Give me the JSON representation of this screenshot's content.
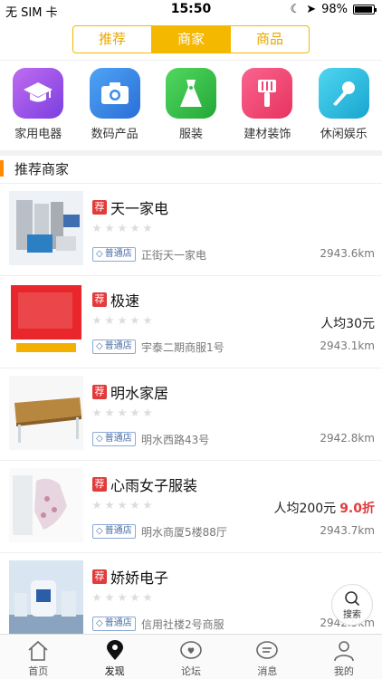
{
  "status": {
    "carrier": "无 SIM 卡",
    "time": "15:50",
    "battery": "98%"
  },
  "segments": [
    {
      "label": "推荐",
      "active": false
    },
    {
      "label": "商家",
      "active": true
    },
    {
      "label": "商品",
      "active": false
    }
  ],
  "categories": [
    {
      "label": "家用电器",
      "icon": "graduation-cap-icon",
      "color": "#9b59e6"
    },
    {
      "label": "数码产品",
      "icon": "camera-icon",
      "color": "#3b8de6"
    },
    {
      "label": "服装",
      "icon": "dress-icon",
      "color": "#3cc24a"
    },
    {
      "label": "建材装饰",
      "icon": "paint-brush-icon",
      "color": "#f0487a"
    },
    {
      "label": "休闲娱乐",
      "icon": "microphone-icon",
      "color": "#2cc1e0"
    }
  ],
  "section_title": "推荐商家",
  "shops": [
    {
      "tag": "荐",
      "name": "天一家电",
      "badge": "普通店",
      "address": "正街天一家电",
      "distance": "2943.6km",
      "avg": "",
      "discount": ""
    },
    {
      "tag": "荐",
      "name": "极速",
      "badge": "普通店",
      "address": "宇泰二期商服1号",
      "distance": "2943.1km",
      "avg": "人均30元",
      "discount": ""
    },
    {
      "tag": "荐",
      "name": "明水家居",
      "badge": "普通店",
      "address": "明水西路43号",
      "distance": "2942.8km",
      "avg": "",
      "discount": ""
    },
    {
      "tag": "荐",
      "name": "心雨女子服装",
      "badge": "普通店",
      "address": "明水商厦5楼88厅",
      "distance": "2943.7km",
      "avg": "人均200元",
      "discount": "9.0折"
    },
    {
      "tag": "荐",
      "name": "娇娇电子",
      "badge": "普通店",
      "address": "信用社楼2号商服",
      "distance": "2942.5km",
      "avg": "",
      "discount": ""
    }
  ],
  "floating_search": "搜索",
  "tabs": [
    {
      "label": "首页",
      "icon": "home-icon",
      "active": false
    },
    {
      "label": "发现",
      "icon": "location-icon",
      "active": true
    },
    {
      "label": "论坛",
      "icon": "heart-chat-icon",
      "active": false
    },
    {
      "label": "消息",
      "icon": "message-icon",
      "active": false
    },
    {
      "label": "我的",
      "icon": "user-icon",
      "active": false
    }
  ]
}
